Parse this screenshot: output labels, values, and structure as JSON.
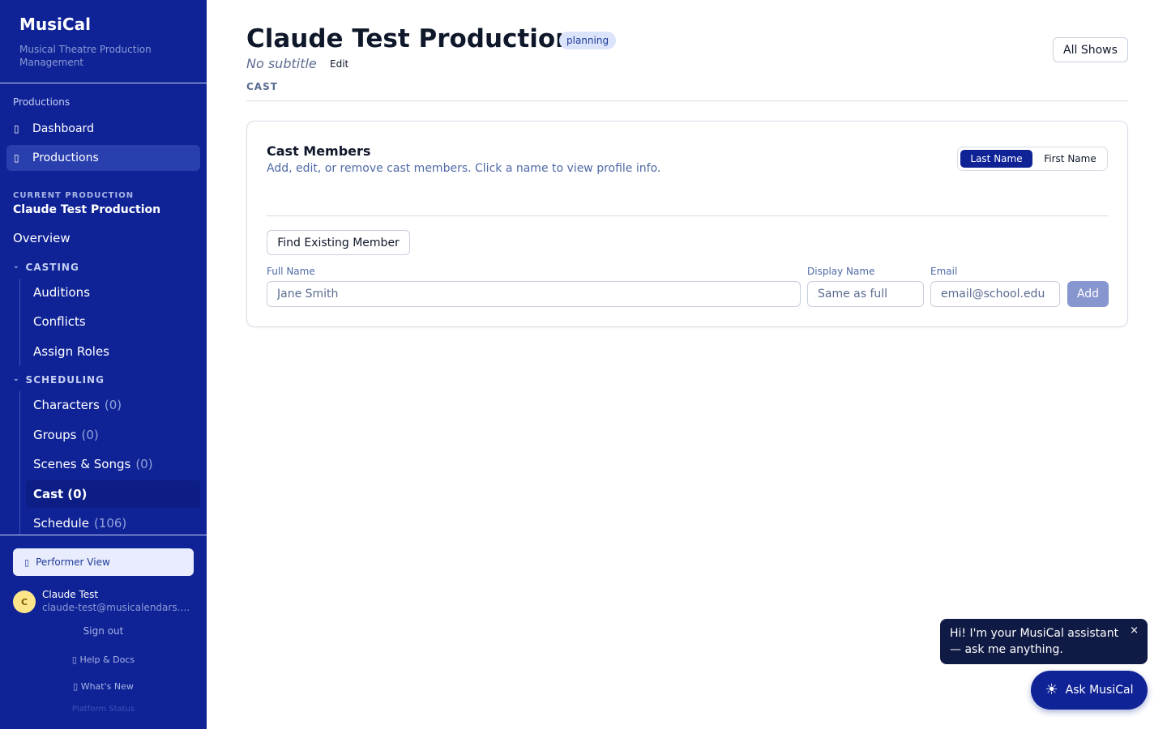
{
  "brand": {
    "name": "MusiCal",
    "subtitle": "Musical Theatre Production Management"
  },
  "sidebar": {
    "section_label": "Productions",
    "nav": [
      {
        "label": "Dashboard",
        "icon": "dashboard-icon"
      },
      {
        "label": "Productions",
        "icon": "productions-icon"
      }
    ],
    "current_label": "CURRENT PRODUCTION",
    "current_name": "Claude Test Production",
    "overview": "Overview",
    "casting_label": "CASTING",
    "casting_items": [
      {
        "label": "Auditions"
      },
      {
        "label": "Conflicts"
      },
      {
        "label": "Assign Roles"
      }
    ],
    "scheduling_label": "SCHEDULING",
    "scheduling_items": [
      {
        "label": "Characters",
        "count": "(0)"
      },
      {
        "label": "Groups",
        "count": "(0)"
      },
      {
        "label": "Scenes & Songs",
        "count": "(0)"
      },
      {
        "label": "Cast",
        "count": "(0)"
      },
      {
        "label": "Schedule",
        "count": "(106)"
      }
    ],
    "performer_view": "Performer View",
    "user": {
      "initial": "C",
      "name": "Claude Test",
      "email": "claude-test@musicalendars.com"
    },
    "sign_out": "Sign out",
    "help": "Help & Docs",
    "whats_new": "What's New",
    "platform_status": "Platform Status"
  },
  "header": {
    "title": "Claude Test Production",
    "status_badge": "planning",
    "subtitle": "No subtitle",
    "edit_label": "Edit",
    "section": "CAST",
    "all_shows": "All Shows"
  },
  "card": {
    "title": "Cast Members",
    "description": "Add, edit, or remove cast members. Click a name to view profile info.",
    "sort_options": [
      "Last Name",
      "First Name"
    ],
    "sort_selected": "Last Name",
    "find_button": "Find Existing Member",
    "fields": {
      "full_name_label": "Full Name",
      "full_name_placeholder": "Jane Smith",
      "display_name_label": "Display Name",
      "display_name_placeholder": "Same as full",
      "email_label": "Email",
      "email_placeholder": "email@school.edu"
    },
    "add_button": "Add"
  },
  "assistant": {
    "greeting": "Hi! I'm your MusiCal assistant — ask me anything.",
    "close": "×",
    "button_label": "Ask MusiCal"
  },
  "colors": {
    "sidebar_bg": "#0f2396",
    "accent": "#0f2396",
    "badge_bg": "#dbe4fb"
  }
}
